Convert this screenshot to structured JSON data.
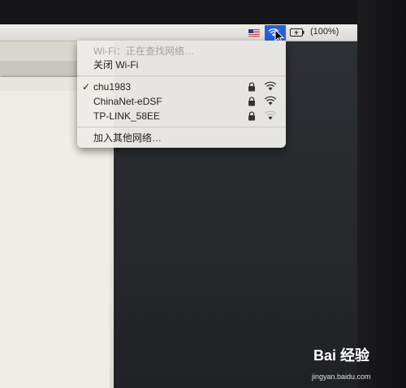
{
  "menubar": {
    "battery_text": "(100%)",
    "flag_icon": "us-flag-icon",
    "wifi_icon": "wifi-icon",
    "highlight_color": "#2a5fd8"
  },
  "wifi_menu": {
    "status": "Wi-Fi：正在查找网络…",
    "toggle": "关闭 Wi-Fi",
    "networks": [
      {
        "name": "chu1983",
        "connected": true,
        "secured": true,
        "signal": 0.9
      },
      {
        "name": "ChinaNet-eDSF",
        "connected": false,
        "secured": true,
        "signal": 0.9
      },
      {
        "name": "TP-LINK_58EE",
        "connected": false,
        "secured": true,
        "signal": 0.3
      }
    ],
    "join_other": "加入其他网络…",
    "checkmark": "✓"
  },
  "watermark": {
    "logo": "Bai 经验",
    "url": "jingyan.baidu.com"
  }
}
